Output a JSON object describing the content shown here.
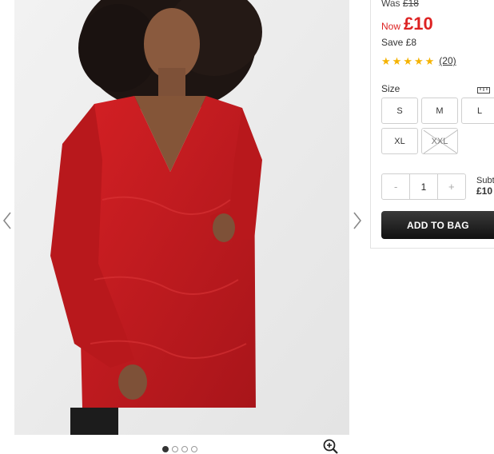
{
  "product": {
    "image_alt": "Model wearing red fluffy cable knit jumper dress",
    "was_label": "Was",
    "was_price": "£18",
    "now_label": "Now",
    "now_price": "£10",
    "save_text": "Save £8",
    "rating_value": 5,
    "rating_count": "(20)"
  },
  "size": {
    "label": "Size",
    "options": [
      {
        "label": "S",
        "available": true
      },
      {
        "label": "M",
        "available": true
      },
      {
        "label": "L",
        "available": true
      },
      {
        "label": "XL",
        "available": true
      },
      {
        "label": "XXL",
        "available": false
      }
    ]
  },
  "quantity": {
    "minus": "-",
    "value": "1",
    "plus": "+"
  },
  "subtotal": {
    "label": "Subtotal",
    "label_visible": "Subt",
    "amount_visible": "£10"
  },
  "actions": {
    "add_to_bag": "ADD TO BAG"
  },
  "gallery": {
    "total_images": 4,
    "active_index": 0
  },
  "colors": {
    "price_red": "#dd2222",
    "star_gold": "#f5b301",
    "sweater_red": "#c8191c"
  }
}
